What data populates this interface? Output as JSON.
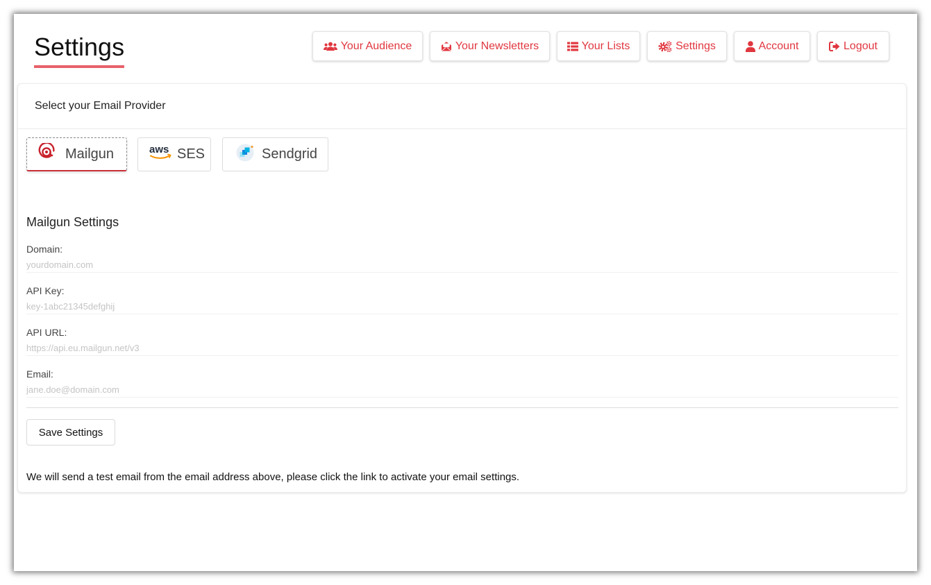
{
  "header": {
    "title": "Settings"
  },
  "nav": {
    "audience": "Your Audience",
    "newsletters": "Your Newsletters",
    "lists": "Your Lists",
    "settings": "Settings",
    "account": "Account",
    "logout": "Logout"
  },
  "card": {
    "header": "Select your Email Provider",
    "providers": [
      {
        "label": "Mailgun",
        "icon": "mailgun-icon",
        "active": true
      },
      {
        "label": "SES",
        "icon": "aws-icon",
        "active": false
      },
      {
        "label": "Sendgrid",
        "icon": "sendgrid-icon",
        "active": false
      }
    ]
  },
  "form": {
    "section_title": "Mailgun Settings",
    "fields": [
      {
        "label": "Domain:",
        "placeholder": "yourdomain.com"
      },
      {
        "label": "API Key:",
        "placeholder": "key-1abc21345defghij"
      },
      {
        "label": "API URL:",
        "placeholder": "https://api.eu.mailgun.net/v3"
      },
      {
        "label": "Email:",
        "placeholder": "jane.doe@domain.com"
      }
    ],
    "save_label": "Save Settings",
    "note": "We will send a test email from the email address above, please click the link to activate your email settings."
  },
  "colors": {
    "accent": "#e0373f",
    "underline": "#e8616b"
  }
}
